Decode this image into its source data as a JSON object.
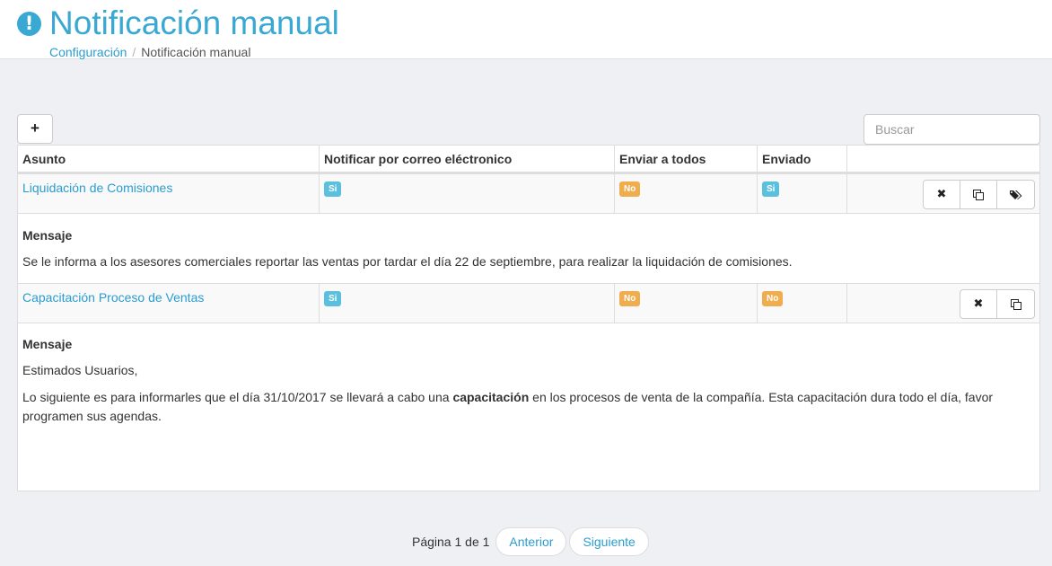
{
  "page": {
    "title": "Notificación manual",
    "title_icon": "exclamation-circle-icon"
  },
  "breadcrumb": {
    "items": [
      {
        "label": "Configuración",
        "link": true
      },
      {
        "label": "Notificación manual",
        "link": false
      }
    ],
    "separator": "/"
  },
  "toolbar": {
    "add_label": "+",
    "search_placeholder": "Buscar"
  },
  "table": {
    "headers": [
      "Asunto",
      "Notificar por correo eléctronico",
      "Enviar a todos",
      "Enviado",
      ""
    ],
    "rows": [
      {
        "subject": "Liquidación de Comisiones",
        "notify_email": "Si",
        "send_all": "No",
        "sent": "Si",
        "actions": [
          "close-icon",
          "copy-icon",
          "tags-icon"
        ],
        "message_label": "Mensaje",
        "message": [
          "Se le informa a los asesores comerciales reportar las ventas por tardar el día 22 de septiembre, para realizar la liquidación de comisiones."
        ]
      },
      {
        "subject": "Capacitación Proceso de Ventas",
        "notify_email": "Si",
        "send_all": "No",
        "sent": "No",
        "actions": [
          "close-icon",
          "copy-icon"
        ],
        "message_label": "Mensaje",
        "message_greeting": "Estimados Usuarios,",
        "message_before": "Lo siguiente es para informarles que el día 31/10/2017 se llevará a cabo una ",
        "message_bold": "capacitación",
        "message_after": " en los procesos de venta de la compañía. Esta capacitación dura todo el día, favor programen sus agendas."
      }
    ]
  },
  "pagination": {
    "info": "Página 1 de 1",
    "prev_label": "Anterior",
    "next_label": "Siguiente"
  },
  "colors": {
    "primary": "#39a8d3",
    "badge_si": "#5bc0de",
    "badge_no": "#f0ad4e",
    "background": "#eff0f4"
  }
}
